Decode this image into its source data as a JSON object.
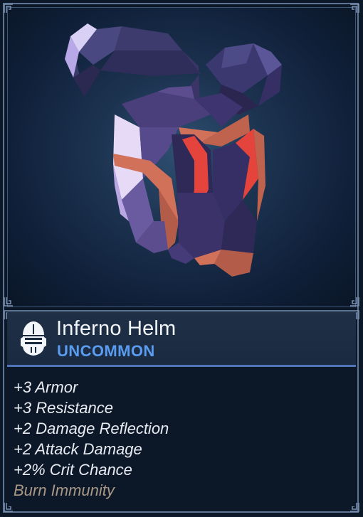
{
  "item": {
    "name": "Inferno Helm",
    "rarity": "UNCOMMON",
    "icon": "knight-helmet-icon"
  },
  "stats": [
    {
      "text": "+3 Armor",
      "special": false
    },
    {
      "text": "+3 Resistance",
      "special": false
    },
    {
      "text": "+2 Damage Reflection",
      "special": false
    },
    {
      "text": "+2 Attack Damage",
      "special": false
    },
    {
      "text": "+2% Crit Chance",
      "special": false
    },
    {
      "text": "Burn Immunity",
      "special": true
    }
  ],
  "colors": {
    "rarity": "#5a9cf0",
    "frame": "#5d7392",
    "special_stat": "#a99886",
    "helm_body": "#4a3f7a",
    "helm_trim": "#d2715a",
    "helm_glow": "#e4443c"
  }
}
